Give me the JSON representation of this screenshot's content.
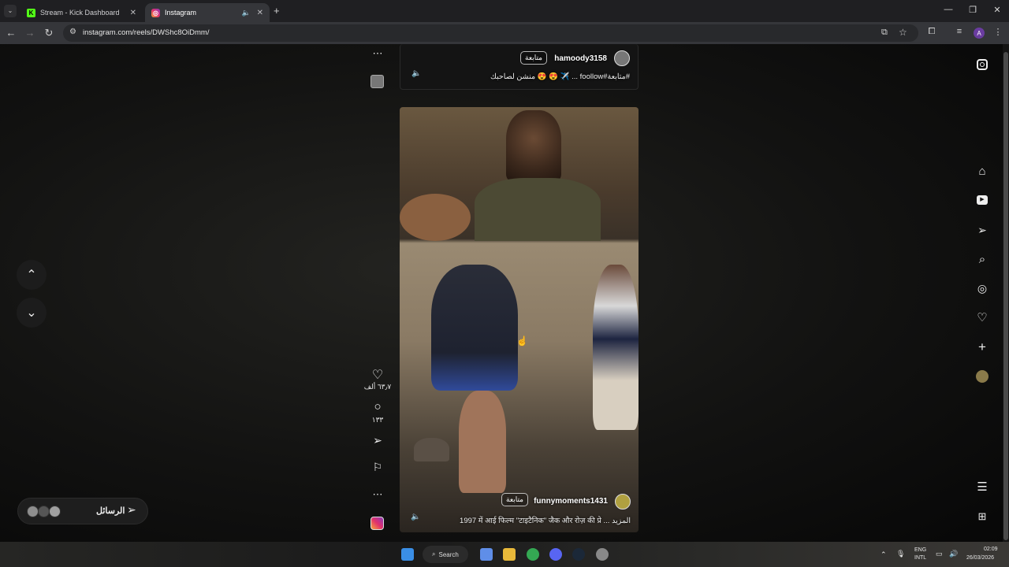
{
  "browser": {
    "tabs": [
      {
        "title": "Stream - Kick Dashboard",
        "icon": "kick-icon"
      },
      {
        "title": "Instagram",
        "icon": "instagram-icon"
      }
    ],
    "url": "instagram.com/reels/DWShc8OiDmm/"
  },
  "colors": {
    "kick": "#53fc18",
    "instagram": "#e1306c",
    "accent": "#6a3ca0"
  },
  "account_initial": "A",
  "prev_reel": {
    "username": "hamoody3158",
    "follow_label": "متابعة",
    "caption": "منشن لصاحبك 😍 😍 ✈️ ... foollow#متابعة#"
  },
  "reel": {
    "username": "funnymoments1431",
    "follow_label": "متابعة",
    "caption": "1997 में आई फिल्म \"टाइटैनिक\" जैक और रोज़ की प्रे ... المزيد"
  },
  "actions": {
    "like_count": "٦٣٫٧ ألف",
    "comment_count": "١٣٣"
  },
  "messages": {
    "label": "الرسائل"
  },
  "taskbar": {
    "search_label": "Search",
    "lang_top": "ENG",
    "lang_bottom": "INTL",
    "time": "02:09",
    "date": "26/03/2026"
  }
}
